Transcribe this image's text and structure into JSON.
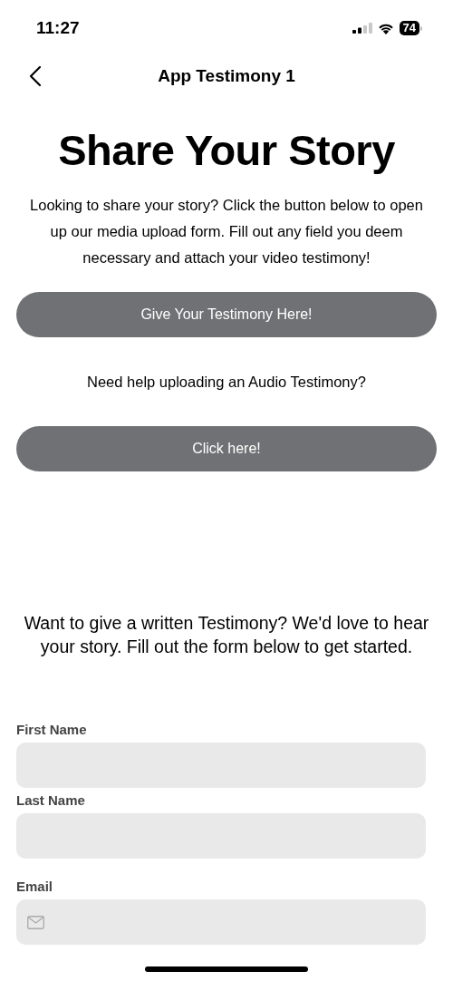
{
  "status_bar": {
    "time": "11:27",
    "battery": "74"
  },
  "nav": {
    "title": "App Testimony 1"
  },
  "heading": "Share Your Story",
  "intro": "Looking to share your story? Click the button below to open up our media upload form. Fill out any field you deem necessary and attach your video testimony!",
  "upload_button": "Give Your Testimony Here!",
  "audio_help": "Need help uploading an Audio Testimony?",
  "audio_button": "Click here!",
  "written_intro": "Want to give a written Testimony? We'd love to hear your story. Fill out the form below to get started.",
  "form_fields": [
    {
      "label": "First Name",
      "kind": "text"
    },
    {
      "label": "Last Name",
      "kind": "text"
    },
    {
      "label": "Email",
      "kind": "email"
    }
  ]
}
